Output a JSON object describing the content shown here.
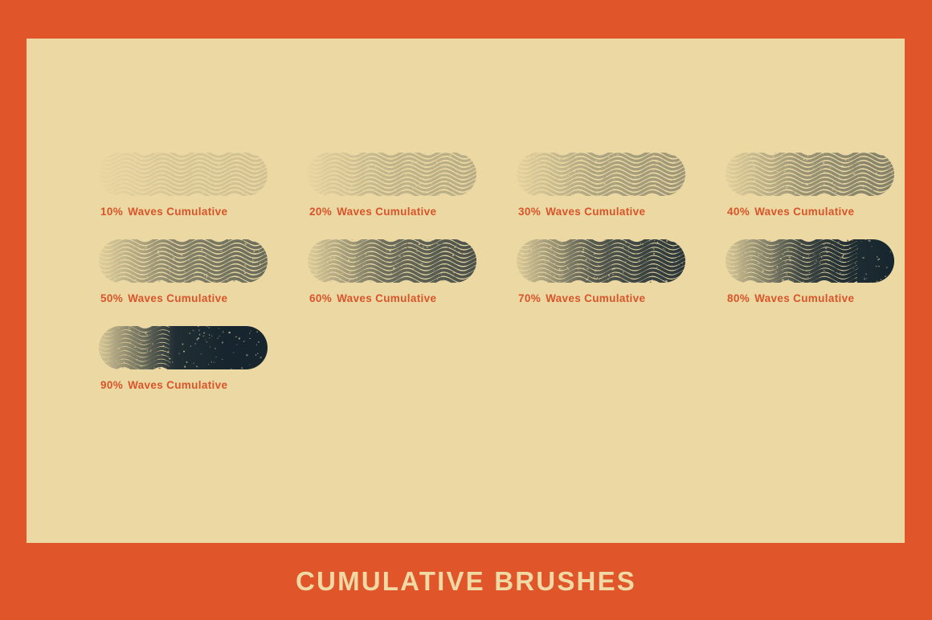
{
  "theme": {
    "frame_color": "#E0552A",
    "canvas_color": "#EBD8A2",
    "ink_color": "#16252E",
    "label_color": "#D8552B",
    "footer_text_color": "#EFD9A4"
  },
  "footer": {
    "title": "CUMULATIVE BRUSHES"
  },
  "swatches": [
    {
      "percent": "10%",
      "word1": "Waves",
      "word2": "Cumulative",
      "opacity": 0.1,
      "fade_start": 0.0
    },
    {
      "percent": "20%",
      "word1": "Waves",
      "word2": "Cumulative",
      "opacity": 0.2,
      "fade_start": 0.04
    },
    {
      "percent": "30%",
      "word1": "Waves",
      "word2": "Cumulative",
      "opacity": 0.3,
      "fade_start": 0.08
    },
    {
      "percent": "40%",
      "word1": "Waves",
      "word2": "Cumulative",
      "opacity": 0.4,
      "fade_start": 0.12
    },
    {
      "percent": "50%",
      "word1": "Waves",
      "word2": "Cumulative",
      "opacity": 0.5,
      "fade_start": 0.16
    },
    {
      "percent": "60%",
      "word1": "Waves",
      "word2": "Cumulative",
      "opacity": 0.62,
      "fade_start": 0.2
    },
    {
      "percent": "70%",
      "word1": "Waves",
      "word2": "Cumulative",
      "opacity": 0.74,
      "fade_start": 0.24
    },
    {
      "percent": "80%",
      "word1": "Waves",
      "word2": "Cumulative",
      "opacity": 0.86,
      "fade_start": 0.28
    },
    {
      "percent": "90%",
      "word1": "Waves",
      "word2": "Cumulative",
      "opacity": 1.0,
      "fade_start": 0.32
    }
  ]
}
